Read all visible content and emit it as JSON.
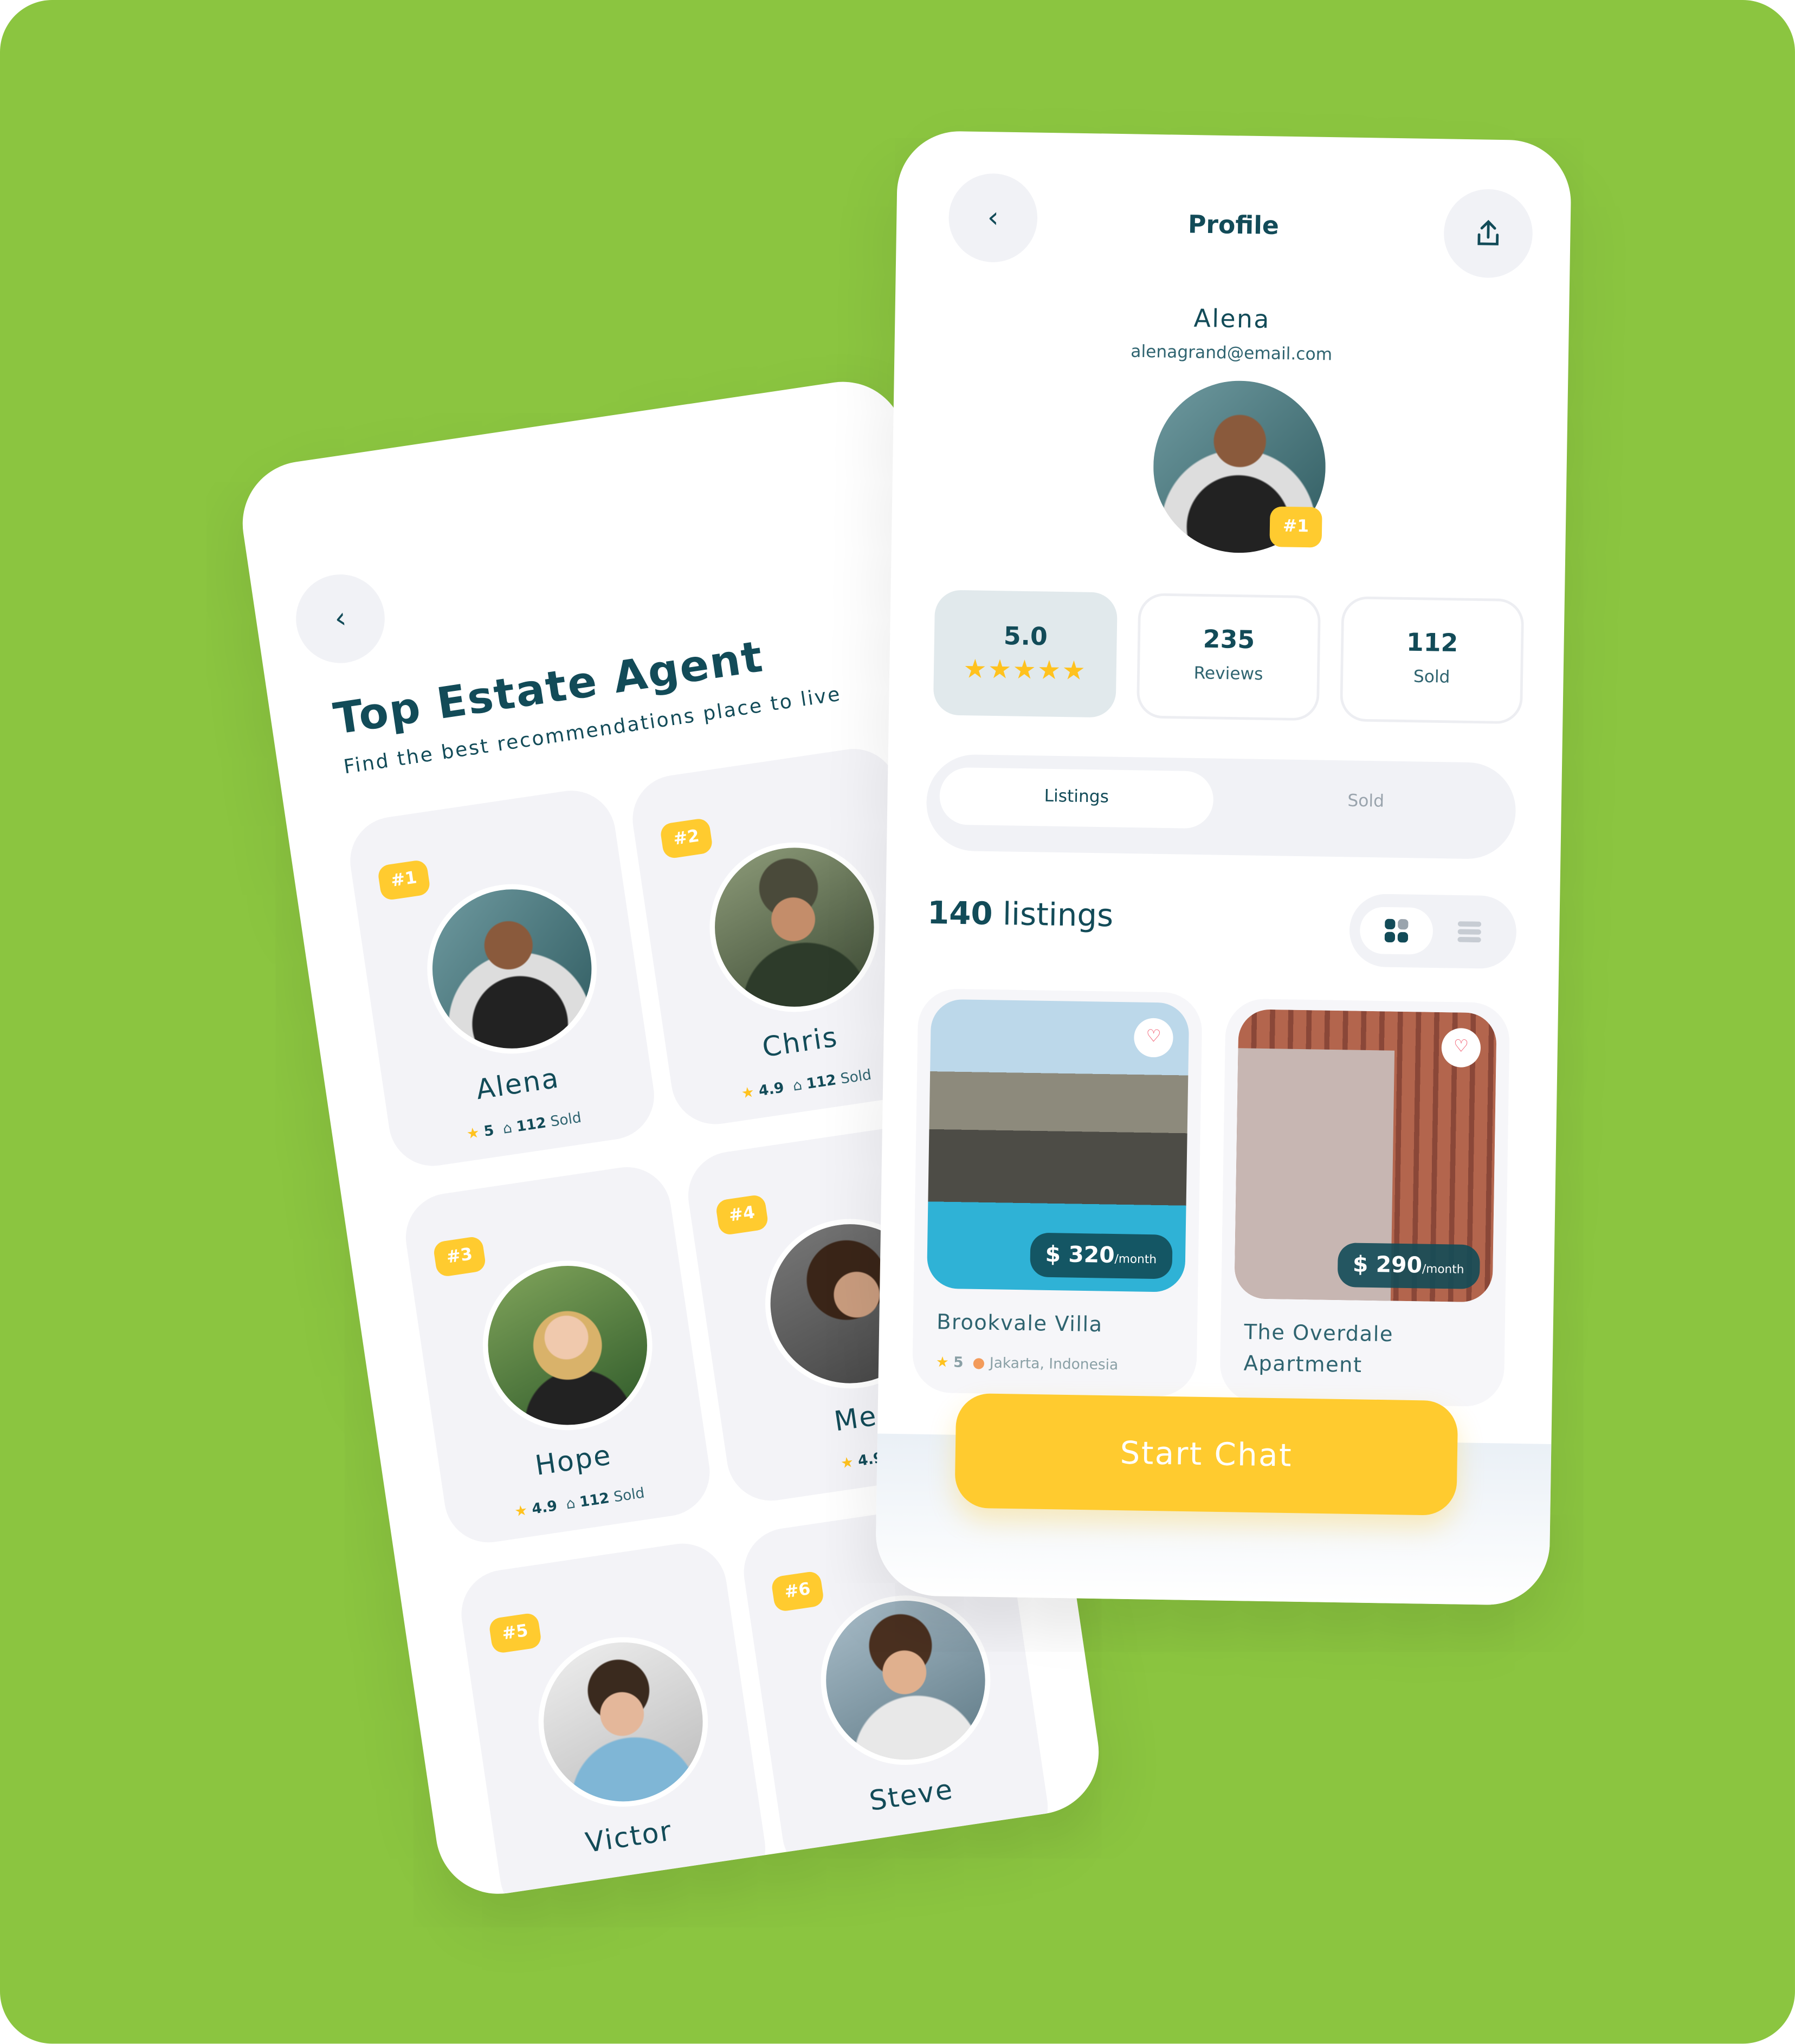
{
  "colors": {
    "background": "#8BC540",
    "accent": "#FFCB2F",
    "text": "#124B58",
    "heart": "#F0475E"
  },
  "agents_screen": {
    "back_icon": "chevron-left-icon",
    "title": "Top Estate Agent",
    "subtitle": "Find the best recommendations place to live",
    "agents": [
      {
        "rank": "#1",
        "name": "Alena",
        "rating": "5",
        "sold_count": "112",
        "sold_label": "Sold"
      },
      {
        "rank": "#2",
        "name": "Chris",
        "rating": "4.9",
        "sold_count": "112",
        "sold_label": "Sold"
      },
      {
        "rank": "#3",
        "name": "Hope",
        "rating": "4.9",
        "sold_count": "112",
        "sold_label": "Sold"
      },
      {
        "rank": "#4",
        "name": "Me",
        "rating": "4.9",
        "sold_count": "",
        "sold_label": ""
      },
      {
        "rank": "#5",
        "name": "Victor",
        "rating": "",
        "sold_count": "",
        "sold_label": ""
      },
      {
        "rank": "#6",
        "name": "Steve",
        "rating": "",
        "sold_count": "",
        "sold_label": ""
      }
    ]
  },
  "profile_screen": {
    "title": "Profile",
    "back_icon": "chevron-left-icon",
    "share_icon": "share-icon",
    "name": "Alena",
    "email": "alenagrand@email.com",
    "rank": "#1",
    "stats": {
      "rating": "5.0",
      "stars": 5,
      "reviews": "235",
      "reviews_label": "Reviews",
      "sold": "112",
      "sold_label": "Sold"
    },
    "tabs": [
      {
        "label": "Listings",
        "active": true
      },
      {
        "label": "Sold",
        "active": false
      }
    ],
    "listings_count": "140",
    "listings_label": "listings",
    "view_mode": "grid",
    "listings": [
      {
        "name": "Brookvale Villa",
        "price": "$ 320",
        "period": "/month",
        "rating": "5",
        "location": "Jakarta, Indonesia"
      },
      {
        "name": "The Overdale Apartment",
        "price": "$ 290",
        "period": "/month"
      }
    ],
    "cta": "Start Chat"
  }
}
